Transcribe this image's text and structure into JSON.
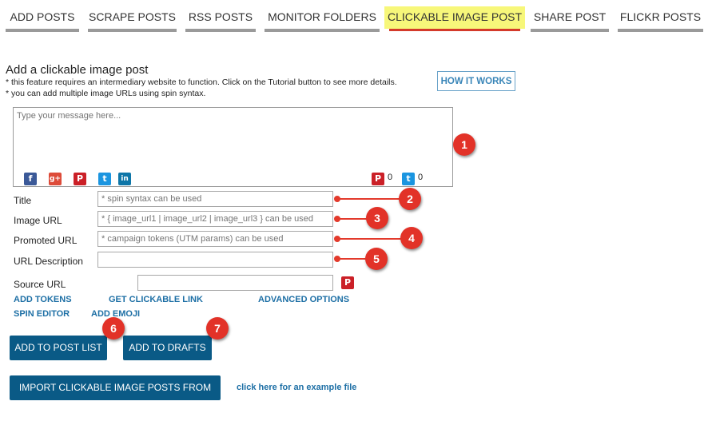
{
  "tabs": [
    {
      "label": "ADD POSTS"
    },
    {
      "label": "SCRAPE POSTS"
    },
    {
      "label": "RSS POSTS"
    },
    {
      "label": "MONITOR FOLDERS"
    },
    {
      "label": "CLICKABLE IMAGE POST",
      "active": true
    },
    {
      "label": "SHARE POST"
    },
    {
      "label": "FLICKR POSTS"
    }
  ],
  "section": {
    "title": "Add a clickable image post",
    "note1": "* this feature requires an intermediary website to function. Click on the Tutorial button to see more details.",
    "note2": "* you can add multiple image URLs using spin syntax.",
    "how_button": "HOW IT WORKS"
  },
  "message": {
    "placeholder": "Type your message here...",
    "social_icons": [
      "facebook-icon",
      "google-plus-icon",
      "pinterest-icon",
      "twitter-icon",
      "linkedin-icon"
    ],
    "pinterest_count": "0",
    "twitter_count": "0"
  },
  "form": {
    "title_label": "Title",
    "title_placeholder": "* spin syntax can be used",
    "image_url_label": "Image URL",
    "image_url_placeholder": "* { image_url1 | image_url2 | image_url3 } can be used",
    "promoted_url_label": "Promoted URL",
    "promoted_url_placeholder": "* campaign tokens (UTM params) can be used",
    "url_description_label": "URL Description",
    "url_description_value": "",
    "source_url_label": "Source URL",
    "source_url_value": ""
  },
  "links": {
    "add_tokens": "ADD TOKENS",
    "get_clickable_link": "GET CLICKABLE LINK",
    "advanced_options": "ADVANCED OPTIONS",
    "spin_editor": "SPIN EDITOR",
    "add_emoji": "ADD EMOJI",
    "example_file": "click here for an example file"
  },
  "buttons": {
    "add_to_post_list": "ADD TO POST LIST",
    "add_to_drafts": "ADD TO DRAFTS",
    "import_csv": "IMPORT CLICKABLE IMAGE POSTS FROM CSV"
  },
  "callouts": [
    "1",
    "2",
    "3",
    "4",
    "5",
    "6",
    "7"
  ],
  "colors": {
    "accent": "#0a5a86",
    "link": "#1d6fa5",
    "callout": "#e23228",
    "active_tab": "#f7f77a",
    "facebook": "#3b5998",
    "google_plus": "#dd4b39",
    "pinterest": "#cb2027",
    "twitter": "#1b95e0",
    "linkedin": "#0e76a8"
  }
}
